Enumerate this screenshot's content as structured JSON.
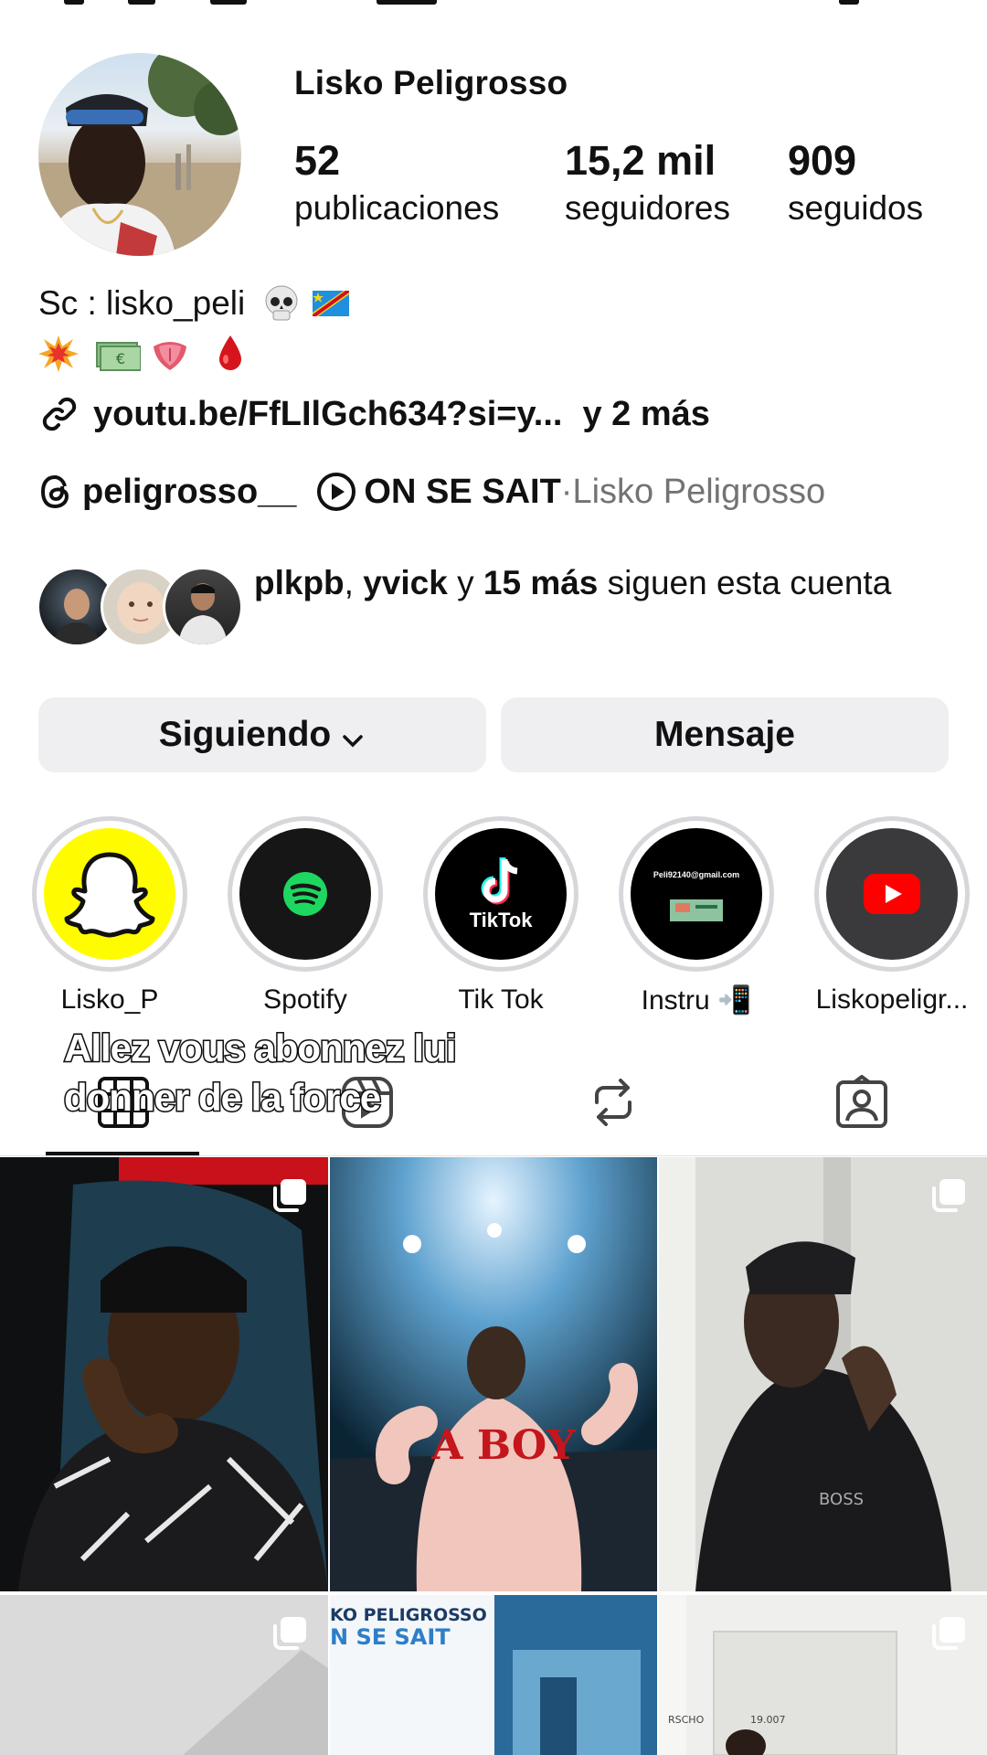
{
  "profile": {
    "name": "Lisko Peligrosso",
    "stats": [
      {
        "value": "52",
        "label": "publicaciones"
      },
      {
        "value": "15,2 mil",
        "label": "seguidores"
      },
      {
        "value": "909",
        "label": "seguidos"
      }
    ]
  },
  "bio": {
    "line1": "Sc : lisko_peli",
    "line1_emojis": [
      "skull-emoji",
      "dr-congo-flag-emoji"
    ],
    "line2_emojis": [
      "collision-emoji",
      "euro-banknote-emoji",
      "tongue-emoji",
      "blood-drop-emoji"
    ],
    "link_text": "youtu.be/FfLIlGch634?si=y...",
    "link_more": "y 2 más",
    "threads_handle": "peligrosso__",
    "music_title": "ON SE SAIT",
    "music_separator": " · ",
    "music_artist": "Lisko Peligrosso"
  },
  "followed_by": {
    "user1": "plkpb",
    "sep": ", ",
    "user2": "yvick",
    "conj": " y ",
    "more": "15 más",
    "tail": " siguen esta cuenta"
  },
  "buttons": {
    "following": "Siguiendo",
    "message": "Mensaje"
  },
  "highlights": [
    {
      "label": "Lisko_P",
      "icon": "snapchat-icon"
    },
    {
      "label": "Spotify",
      "icon": "spotify-icon"
    },
    {
      "label": "Tik Tok",
      "icon": "tiktok-icon",
      "cover_text": "TikTok"
    },
    {
      "label": "Instru 📲",
      "icon": "email-cover",
      "cover_text": "Peli92140@gmail.com"
    },
    {
      "label": "Liskopeligr...",
      "icon": "youtube-icon"
    }
  ],
  "tabs": [
    "grid-icon",
    "reels-icon",
    "reposts-icon",
    "tagged-icon"
  ],
  "overlay_caption": {
    "line1": "Allez vous abonnez lui",
    "line2": "donner de la force"
  },
  "grid": {
    "tile2_text": "A BOY",
    "tile5_text1": "KO PELIGROSSO",
    "tile5_text2": "N SE SAIT",
    "tile6_text1": "RSCHO",
    "tile6_text2": "19.007",
    "tile3_text": "BOSS"
  },
  "colors": {
    "button_bg": "#efeff2",
    "secondary_text": "#737373",
    "snapchat_yellow": "#fffc00",
    "spotify_green": "#1ed760",
    "youtube_red": "#ff0000"
  }
}
